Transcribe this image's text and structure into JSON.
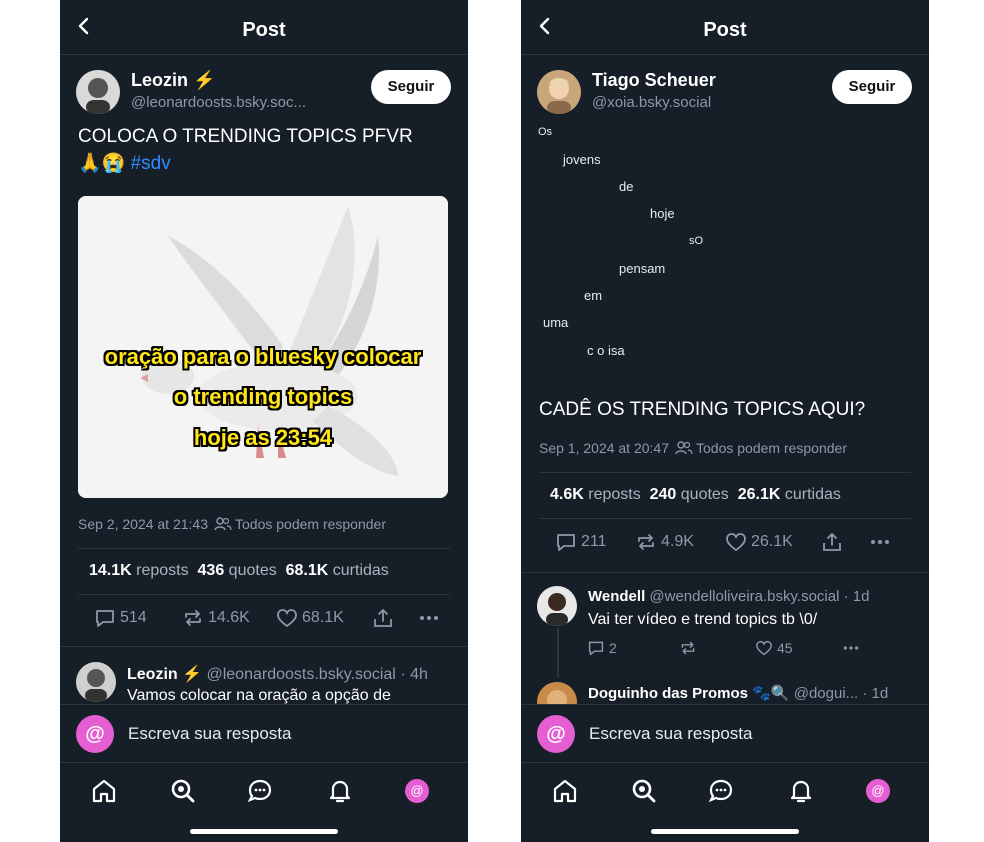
{
  "left": {
    "header_title": "Post",
    "author_name": "Leozin ⚡",
    "author_handle": "@leonardoosts.bsky.soc...",
    "follow_label": "Seguir",
    "post_line1": "COLOCA O TRENDING TOPICS PFVR",
    "post_line2_emoji": "🙏😭",
    "post_hashtag": "#sdv",
    "image_caption": [
      "oração para o bluesky colocar",
      "o trending topics",
      "hoje as 23:54"
    ],
    "timestamp": "Sep 2, 2024 at 21:43",
    "reply_permission": "Todos podem responder",
    "stats": {
      "reposts_value": "14.1K",
      "reposts_label": "reposts",
      "quotes_value": "436",
      "quotes_label": "quotes",
      "likes_value": "68.1K",
      "likes_label": "curtidas"
    },
    "actions": {
      "replies": "514",
      "reposts": "14.6K",
      "likes": "68.1K"
    },
    "reply": {
      "name": "Leozin ⚡",
      "handle": "@leonardoosts.bsky.social",
      "time": "· 4h",
      "text": "Vamos colocar na oração a opção de"
    },
    "composer_placeholder": "Escreva sua resposta"
  },
  "right": {
    "header_title": "Post",
    "author_name": "Tiago Scheuer",
    "author_handle": "@xoia.bsky.social",
    "follow_label": "Seguir",
    "scattered_words": [
      "Os",
      "jovens",
      "de",
      "hoje",
      "sO",
      "pensam",
      "em",
      "uma",
      "c o isa"
    ],
    "post_text": "CADÊ OS TRENDING TOPICS AQUI?",
    "timestamp": "Sep 1, 2024 at 20:47",
    "reply_permission": "Todos podem responder",
    "stats": {
      "reposts_value": "4.6K",
      "reposts_label": "reposts",
      "quotes_value": "240",
      "quotes_label": "quotes",
      "likes_value": "26.1K",
      "likes_label": "curtidas"
    },
    "actions": {
      "replies": "211",
      "reposts": "4.9K",
      "likes": "26.1K"
    },
    "reply1": {
      "name": "Wendell",
      "handle": "@wendelloliveira.bsky.social",
      "time": "· 1d",
      "text": "Vai ter vídeo e trend topics tb \\0/",
      "replies": "2",
      "likes": "45"
    },
    "reply2": {
      "name": "Doguinho das Promos",
      "emoji": "🐾🔍",
      "handle": "@dogui...",
      "time": "· 1d"
    },
    "composer_placeholder": "Escreva sua resposta"
  },
  "colors": {
    "background": "#161e27",
    "accent_pink": "#e55fd3",
    "hashtag_blue": "#2f8bff",
    "caption_yellow": "#ffe51a"
  },
  "icons": [
    "back-icon",
    "avatar",
    "people-icon",
    "reply-icon",
    "repost-icon",
    "heart-icon",
    "share-icon",
    "more-icon",
    "home-icon",
    "search-icon",
    "chat-icon",
    "bell-icon",
    "profile-icon"
  ]
}
